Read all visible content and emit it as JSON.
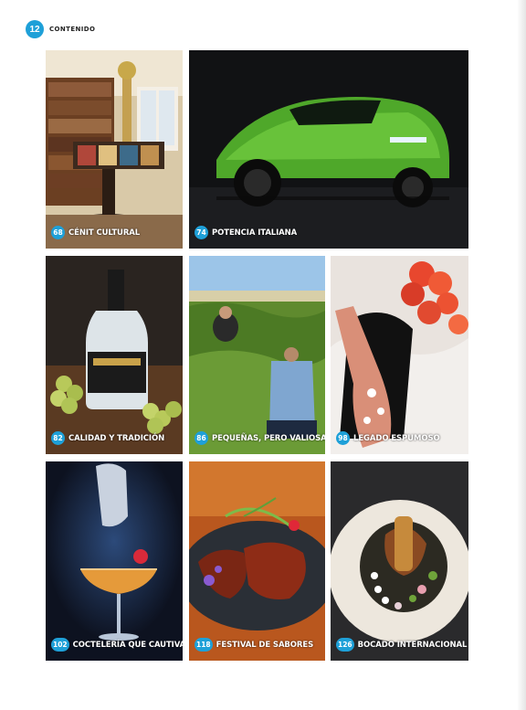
{
  "header": {
    "page_number": "12",
    "section": "CONTENIDO"
  },
  "colors": {
    "accent": "#1ea0d8",
    "background": "#ffffff"
  },
  "articles": [
    {
      "page": "68",
      "title": "CÉNIT CULTURAL",
      "image": "bookshelf-globe-photo"
    },
    {
      "page": "74",
      "title": "POTENCIA ITALIANA",
      "image": "green-lamborghini-photo"
    },
    {
      "page": "82",
      "title": "CALIDAD Y TRADICIÓN",
      "image": "rum-bottle-grapes-photo"
    },
    {
      "page": "86",
      "title": "PEQUEÑAS, PERO VALIOSAS",
      "image": "vineyard-harvest-photo"
    },
    {
      "page": "98",
      "title": "LEGADO ESPUMOSO",
      "image": "rose-champagne-photo"
    },
    {
      "page": "102",
      "title": "COCTELERÍA QUE CAUTIVA",
      "image": "cocktail-glass-photo"
    },
    {
      "page": "118",
      "title": "FESTIVAL DE SABORES",
      "image": "meat-dish-flowers-photo"
    },
    {
      "page": "126",
      "title": "BOCADO INTERNACIONAL",
      "image": "gourmet-plate-photo"
    }
  ]
}
